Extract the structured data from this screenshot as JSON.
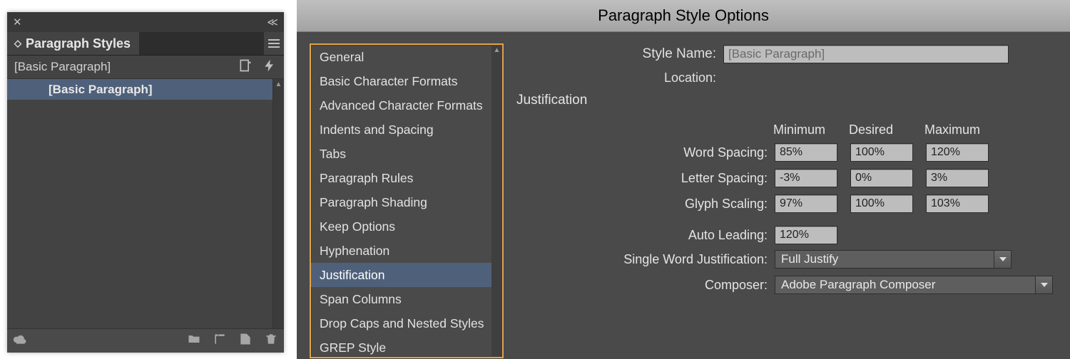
{
  "panel": {
    "title": "Paragraph Styles",
    "header_label": "[Basic Paragraph]",
    "list_items": [
      "[Basic Paragraph]"
    ]
  },
  "dialog": {
    "title": "Paragraph Style Options",
    "style_name_label": "Style Name:",
    "style_name_value": "[Basic Paragraph]",
    "location_label": "Location:",
    "section": "Justification",
    "sidebar": [
      "General",
      "Basic Character Formats",
      "Advanced Character Formats",
      "Indents and Spacing",
      "Tabs",
      "Paragraph Rules",
      "Paragraph Shading",
      "Keep Options",
      "Hyphenation",
      "Justification",
      "Span Columns",
      "Drop Caps and Nested Styles",
      "GREP Style"
    ],
    "sidebar_selected_index": 9,
    "columns": {
      "min": "Minimum",
      "des": "Desired",
      "max": "Maximum"
    },
    "rows": {
      "word": {
        "label": "Word Spacing:",
        "min": "85%",
        "des": "100%",
        "max": "120%"
      },
      "letter": {
        "label": "Letter Spacing:",
        "min": "-3%",
        "des": "0%",
        "max": "3%"
      },
      "glyph": {
        "label": "Glyph Scaling:",
        "min": "97%",
        "des": "100%",
        "max": "103%"
      }
    },
    "auto_leading": {
      "label": "Auto Leading:",
      "value": "120%"
    },
    "single_word": {
      "label": "Single Word Justification:",
      "value": "Full Justify"
    },
    "composer": {
      "label": "Composer:",
      "value": "Adobe Paragraph Composer"
    }
  }
}
